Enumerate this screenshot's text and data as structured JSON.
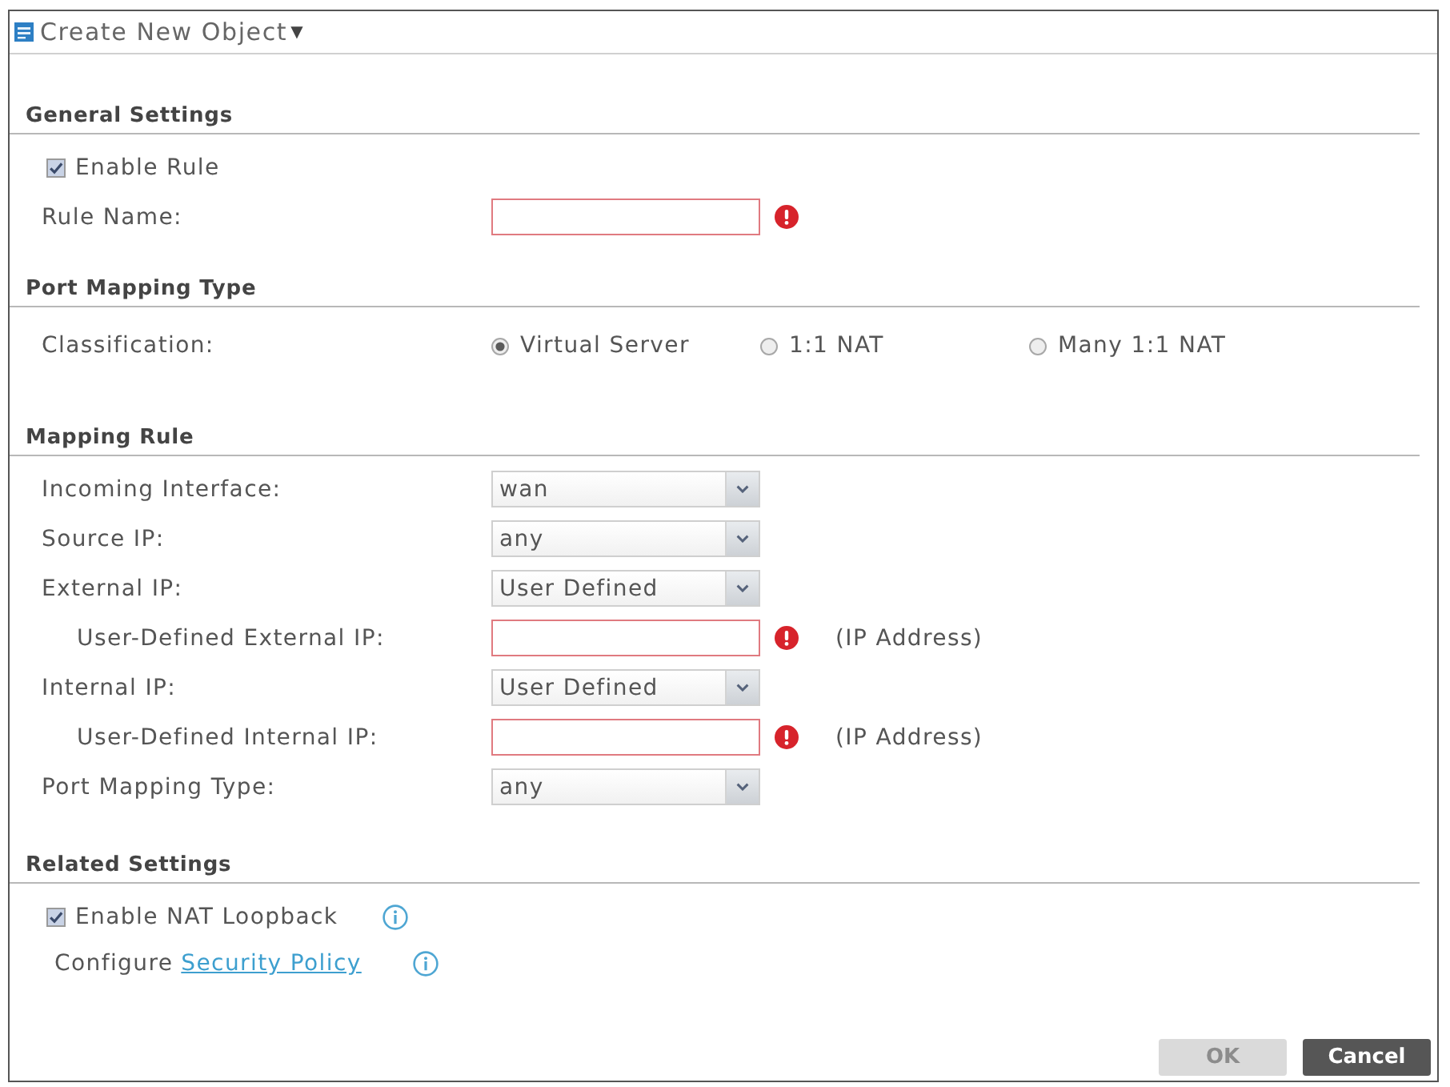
{
  "menu": {
    "label": "Create New Object",
    "caret": "▼"
  },
  "sections": [
    {
      "title": "General Settings",
      "fields": [
        {
          "kind": "checkbox",
          "label": "Enable Rule",
          "checked": true
        },
        {
          "kind": "text",
          "label": "Rule Name:",
          "required": true
        }
      ]
    },
    {
      "title": "Port Mapping Type",
      "fields": [
        {
          "kind": "radio",
          "label": "Classification:",
          "options": [
            {
              "label": "Virtual Server",
              "selected": true
            },
            {
              "label": "1:1 NAT",
              "selected": false
            },
            {
              "label": "Many 1:1 NAT",
              "selected": false
            }
          ]
        }
      ]
    },
    {
      "title": "Mapping Rule",
      "fields": [
        {
          "kind": "select",
          "label": "Incoming Interface:",
          "value": "wan"
        },
        {
          "kind": "select",
          "label": "Source IP:",
          "value": "any"
        },
        {
          "kind": "select",
          "label": "External IP:",
          "value": "User Defined",
          "children": [
            {
              "kind": "text",
              "label": "User-Defined External IP:",
              "required": true,
              "hint": "(IP Address)"
            }
          ]
        },
        {
          "kind": "select",
          "label": "Internal IP:",
          "value": "User Defined",
          "children": [
            {
              "kind": "text",
              "label": "User-Defined Internal IP:",
              "required": true,
              "hint": "(IP Address)"
            }
          ]
        },
        {
          "kind": "select",
          "label": "Port Mapping Type:",
          "value": "any"
        }
      ]
    },
    {
      "title": "Related Settings",
      "fields": [
        {
          "kind": "checkbox",
          "label": "Enable NAT Loopback",
          "checked": true,
          "info": true
        },
        {
          "kind": "link",
          "prefix": "Configure",
          "link": "Security Policy",
          "info": true
        }
      ]
    }
  ],
  "buttons": [
    {
      "label": "OK",
      "disabled": true
    },
    {
      "label": "Cancel",
      "disabled": false
    }
  ]
}
